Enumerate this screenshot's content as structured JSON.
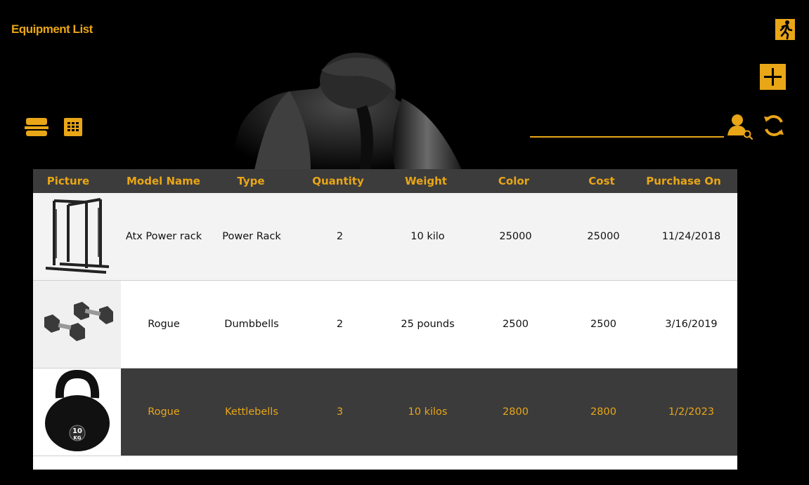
{
  "header": {
    "title": "Equipment List",
    "accent_color": "#e9a617",
    "icons": [
      "exit-icon",
      "add-icon",
      "list-view-icon",
      "grid-view-icon",
      "user-search-icon",
      "refresh-icon"
    ]
  },
  "search": {
    "value": "",
    "placeholder": ""
  },
  "table": {
    "columns": [
      "Picture",
      "Model Name",
      "Type",
      "Quantity",
      "Weight",
      "Color",
      "Cost",
      "Purchase On"
    ],
    "rows": [
      {
        "picture": "power-rack-image",
        "model": "Atx Power rack",
        "type": "Power Rack",
        "quantity": "2",
        "weight": "10 kilo",
        "color": "25000",
        "cost": "25000",
        "purchase": "11/24/2018"
      },
      {
        "picture": "dumbbells-image",
        "model": "Rogue",
        "type": "Dumbbells",
        "quantity": "2",
        "weight": "25 pounds",
        "color": "2500",
        "cost": "2500",
        "purchase": "3/16/2019"
      },
      {
        "picture": "kettlebell-image",
        "model": "Rogue",
        "type": "Kettlebells",
        "quantity": "3",
        "weight": "10 kilos",
        "color": "2800",
        "cost": "2800",
        "purchase": "1/2/2023"
      }
    ]
  },
  "kettlebell_label": {
    "weight": "10",
    "unit": "KG"
  }
}
